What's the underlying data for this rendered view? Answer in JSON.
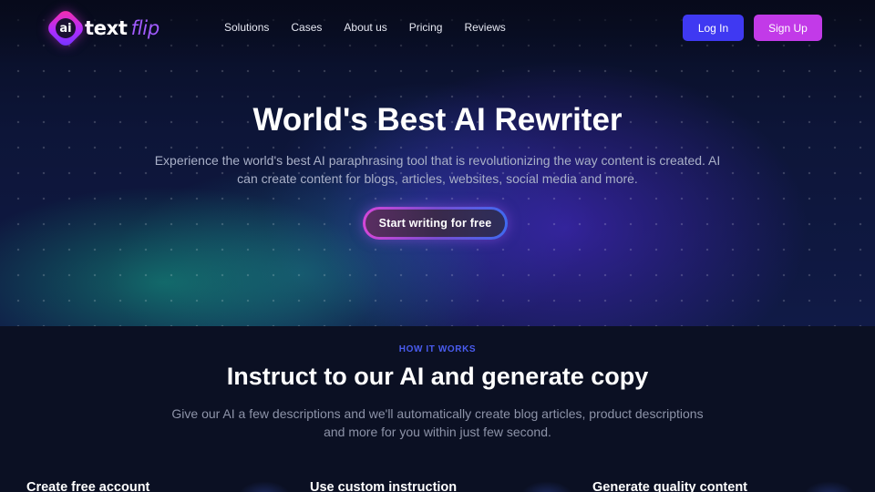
{
  "brand": {
    "mark": "ai",
    "name_part1": "text",
    "name_part2": "flip"
  },
  "nav": {
    "links": [
      "Solutions",
      "Cases",
      "About us",
      "Pricing",
      "Reviews"
    ],
    "login_label": "Log In",
    "signup_label": "Sign Up"
  },
  "hero": {
    "title": "World's Best AI Rewriter",
    "subtitle": "Experience the world's best AI paraphrasing tool that is revolutionizing the way content is created. AI can create content for blogs, articles, websites, social media and more.",
    "cta_label": "Start writing for free"
  },
  "how_it_works": {
    "eyebrow": "HOW IT WORKS",
    "title": "Instruct to our AI and generate copy",
    "subtitle": "Give our AI a few descriptions and we'll automatically create blog articles, product descriptions and more for you within just few second.",
    "steps": [
      {
        "title": "Create free account"
      },
      {
        "title": "Use custom instruction"
      },
      {
        "title": "Generate quality content"
      }
    ]
  },
  "colors": {
    "login_button": "#3f39f2",
    "signup_button": "#c23ae8",
    "eyebrow": "#4a5cf0",
    "background": "#0b1023"
  }
}
